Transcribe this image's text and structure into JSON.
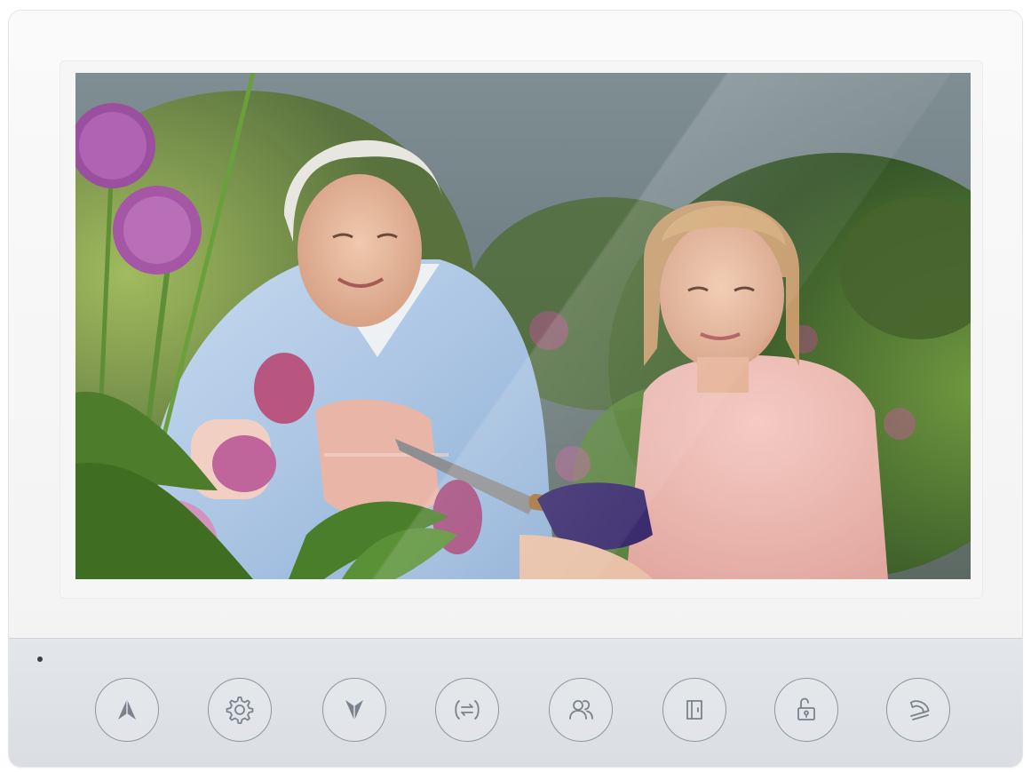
{
  "device": {
    "type": "video intercom monitor",
    "screen_content": "camera-feed",
    "status_led": "off",
    "colors": {
      "frame": "#f4f4f5",
      "button_panel": "#dfe2e6",
      "button_icon": "#7a838c"
    }
  },
  "buttons": [
    {
      "name": "up-button",
      "icon": "up-arrow-icon"
    },
    {
      "name": "settings-button",
      "icon": "gear-icon"
    },
    {
      "name": "down-button",
      "icon": "down-arrow-icon"
    },
    {
      "name": "switch-button",
      "icon": "switch-icon"
    },
    {
      "name": "contacts-button",
      "icon": "users-icon"
    },
    {
      "name": "door-button",
      "icon": "door-icon"
    },
    {
      "name": "unlock-button",
      "icon": "unlock-icon"
    },
    {
      "name": "hangup-button",
      "icon": "phone-hangup-icon"
    }
  ]
}
